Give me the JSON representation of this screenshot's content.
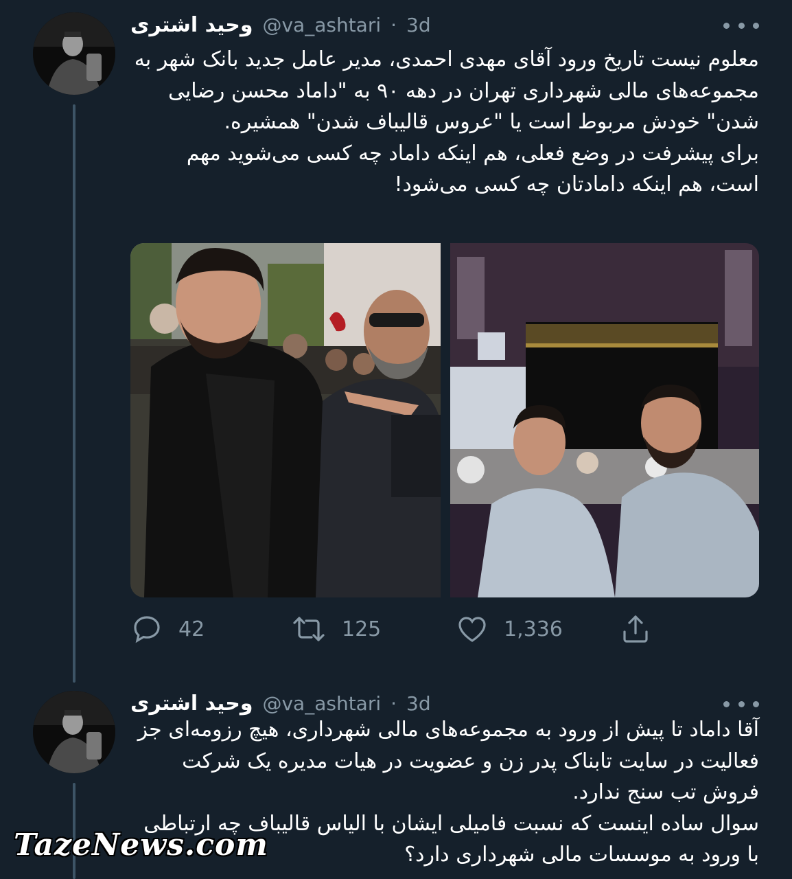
{
  "colors": {
    "background": "#15202b",
    "text": "#ffffff",
    "muted": "#8899a6",
    "thread_line": "#3d5466"
  },
  "tweets": [
    {
      "display_name": "وحید اشتری",
      "handle": "@va_ashtari",
      "separator": "·",
      "age": "3d",
      "paragraphs": [
        "معلوم نیست تاریخ ورود آقای مهدی احمدی، مدیر عامل جدید بانک شهر به مجموعه‌های مالی شهرداری تهران در دهه ۹۰ به \"داماد محسن رضایی شدن\" خودش مربوط است یا \"عروس قالیباف شدن\" همشیره.",
        "برای پیشرفت در وضع فعلی، هم اینکه داماد چه کسی می‌شوید مهم است، هم اینکه دامادتان چه کسی می‌شود!"
      ],
      "stats": {
        "replies": "42",
        "retweets": "125",
        "likes": "1,336"
      },
      "icons": {
        "reply": "reply-icon",
        "retweet": "retweet-icon",
        "like": "heart-icon",
        "share": "share-icon",
        "more": "more-icon"
      }
    },
    {
      "display_name": "وحید اشتری",
      "handle": "@va_ashtari",
      "separator": "·",
      "age": "3d",
      "paragraphs": [
        "آقا داماد تا پیش از ورود به مجموعه‌های مالی شهرداری، هیچ رزومه‌ای جز فعالیت در سایت تابناک پدر زن و عضویت در هیات مدیره یک شرکت فروش تب سنج ندارد.",
        "سوال ساده اینست که نسبت فامیلی ایشان با الیاس قالیباف چه ارتباطی با ورود به موسسات مالی شهرداری دارد؟"
      ]
    }
  ],
  "watermark": "TazeNews.com"
}
